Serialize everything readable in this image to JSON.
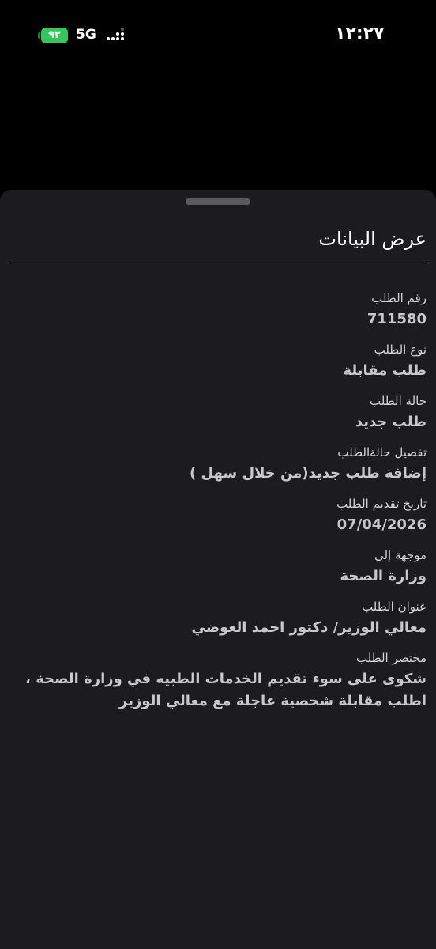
{
  "status_bar": {
    "time": "١٢:٢٧",
    "battery_level": "٩٢",
    "network": "5G",
    "battery_color": "#34c759"
  },
  "sheet": {
    "title": "عرض البيانات",
    "fields": [
      {
        "label": "رقم الطلب",
        "value": "711580"
      },
      {
        "label": "نوع الطلب",
        "value": "طلب مقابلة"
      },
      {
        "label": "حالة الطلب",
        "value": "طلب جديد"
      },
      {
        "label": "تفصيل حالةالطلب",
        "value": "إضافة طلب جديد(من خلال سهل )"
      },
      {
        "label": "تاريخ تقديم الطلب",
        "value": "07/04/2026"
      },
      {
        "label": "موجهة إلى",
        "value": "وزارة الصحة"
      },
      {
        "label": "عنوان الطلب",
        "value": "معالي الوزير/ دكتور احمد العوضي"
      },
      {
        "label": "مختصر الطلب",
        "value": "شكوى على سوء تقديم الخدمات الطبيه في وزارة الصحة ، اطلب مقابلة شخصية عاجلة مع معالي الوزير"
      }
    ]
  },
  "colors": {
    "background": "#000000",
    "sheet": "#1c1c1e",
    "label": "#d4d4d6",
    "value": "#c7c7cc"
  }
}
